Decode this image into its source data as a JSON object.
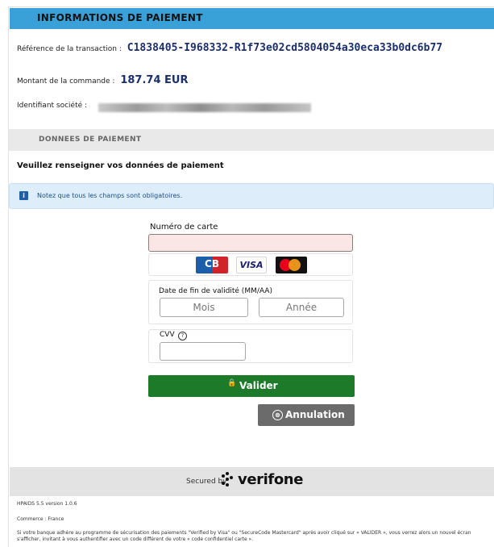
{
  "header": {
    "title": "INFORMATIONS DE PAIEMENT"
  },
  "transaction": {
    "reference_label": "Référence de la transaction :",
    "reference_value": "C1838405-I968332-R1f73e02cd5804054a30eca33b0dc6b77",
    "amount_label": "Montant de la commande :",
    "amount_value": "187.74 EUR",
    "company_label": "Identifiant société :"
  },
  "section": {
    "title": "DONNEES DE PAIEMENT"
  },
  "instruction": "Veuillez renseigner vos données de paiement",
  "notice": {
    "icon": "info-icon",
    "text": "Notez que tous les champs sont obligatoires."
  },
  "form": {
    "card_number_label": "Numéro de carte",
    "brands": {
      "cb": "CB",
      "visa": "VISA",
      "mastercard": "mastercard-logo"
    },
    "expiry_label": "Date de fin de validité (MM/AA)",
    "month_placeholder": "Mois",
    "year_placeholder": "Année",
    "cvv_label": "CVV",
    "help_symbol": "?"
  },
  "buttons": {
    "validate": "Valider",
    "validate_icon": "🔒",
    "cancel": "Annulation",
    "cancel_icon": "⊗"
  },
  "footer": {
    "secured_by": "Secured by",
    "brand": "verifone",
    "version": "HPAIDS 5.5 version 1.0.6",
    "merchant": "Commerce : France",
    "disclaimer": "Si votre banque adhère au programme de sécurisation des paiements \"Verified by Visa\" ou \"SecureCode Mastercard\" après avoir cliqué sur « VALIDER », vous verrez alors un nouvel écran s'afficher, invitant à vous authentifier avec un code différent de votre « code confidentiel carte »."
  },
  "colors": {
    "header_blue": "#3aa0d8",
    "validate_green": "#1d7a28",
    "cancel_gray": "#6b6b6b",
    "card_input_error_bg": "#fbe6e6"
  }
}
